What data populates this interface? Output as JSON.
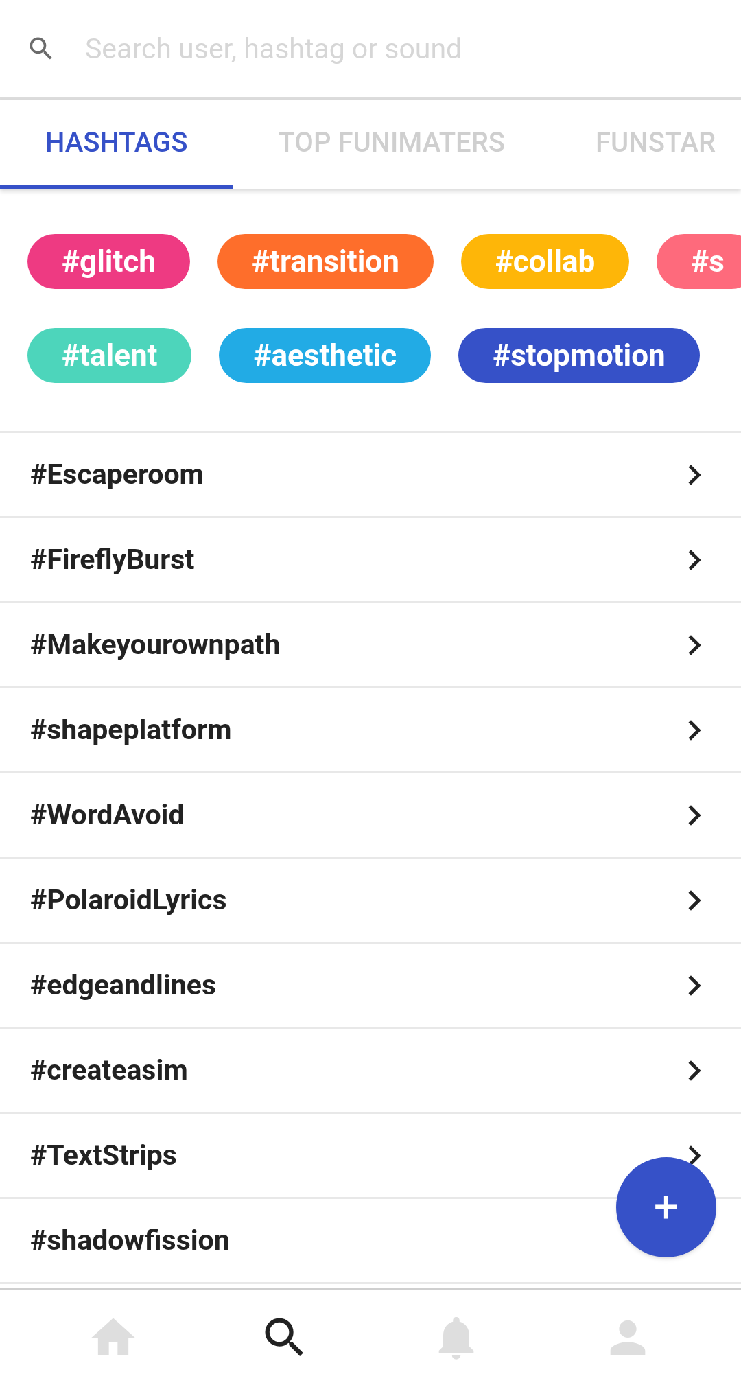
{
  "search": {
    "placeholder": "Search user, hashtag or sound"
  },
  "tabs": [
    {
      "label": "HASHTAGS",
      "selected": true
    },
    {
      "label": "TOP FUNIMATERS",
      "selected": false
    },
    {
      "label": "FUNSTAR",
      "selected": false
    }
  ],
  "chip_rows": [
    [
      {
        "label": "#glitch",
        "color": "#ee3a82"
      },
      {
        "label": "#transition",
        "color": "#fe6e2b"
      },
      {
        "label": "#collab",
        "color": "#feb608"
      },
      {
        "label": "#s",
        "color": "#fe6a7c"
      }
    ],
    [
      {
        "label": "#talent",
        "color": "#4dd5bb"
      },
      {
        "label": "#aesthetic",
        "color": "#22abe5"
      },
      {
        "label": "#stopmotion",
        "color": "#3651c8"
      }
    ]
  ],
  "hashtags": [
    "#Escaperoom",
    "#FireflyBurst",
    "#Makeyourownpath",
    "#shapeplatform",
    "#WordAvoid",
    "#PolaroidLyrics",
    "#edgeandlines",
    "#createasim",
    "#TextStrips",
    "#shadowfission"
  ],
  "fab": {
    "label": "+"
  },
  "nav": [
    {
      "kind": "home",
      "selected": false
    },
    {
      "kind": "search",
      "selected": true
    },
    {
      "kind": "bell",
      "selected": false
    },
    {
      "kind": "profile",
      "selected": false
    }
  ]
}
